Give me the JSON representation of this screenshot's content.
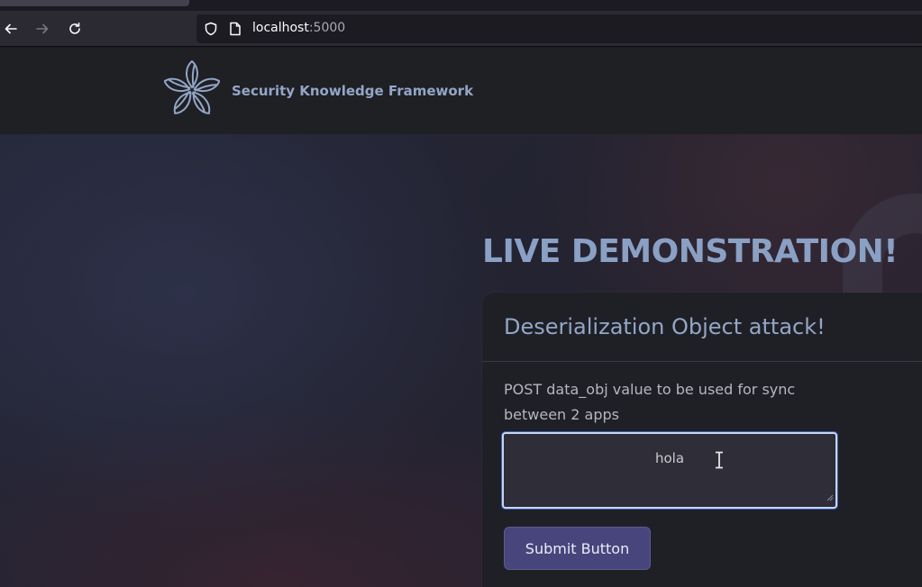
{
  "browser": {
    "url_host": "localhost",
    "url_port": ":5000"
  },
  "site": {
    "brand_name": "Security Knowledge Framework"
  },
  "hero": {
    "headline": "LIVE DEMONSTRATION!"
  },
  "card": {
    "title": "Deserialization Object attack!",
    "description": "POST data_obj value to be used for sync between 2 apps",
    "input_value": "hola",
    "submit_label": "Submit Button"
  },
  "icons": {
    "back": "back-arrow-icon",
    "forward": "forward-arrow-icon",
    "reload": "reload-icon",
    "shield": "shield-icon",
    "page": "page-icon",
    "logo": "flower-logo-icon",
    "cursor": "text-cursor-icon"
  },
  "colors": {
    "accent": "#93a6c7",
    "button": "#47457b",
    "input_focus": "#c6d6f2"
  }
}
